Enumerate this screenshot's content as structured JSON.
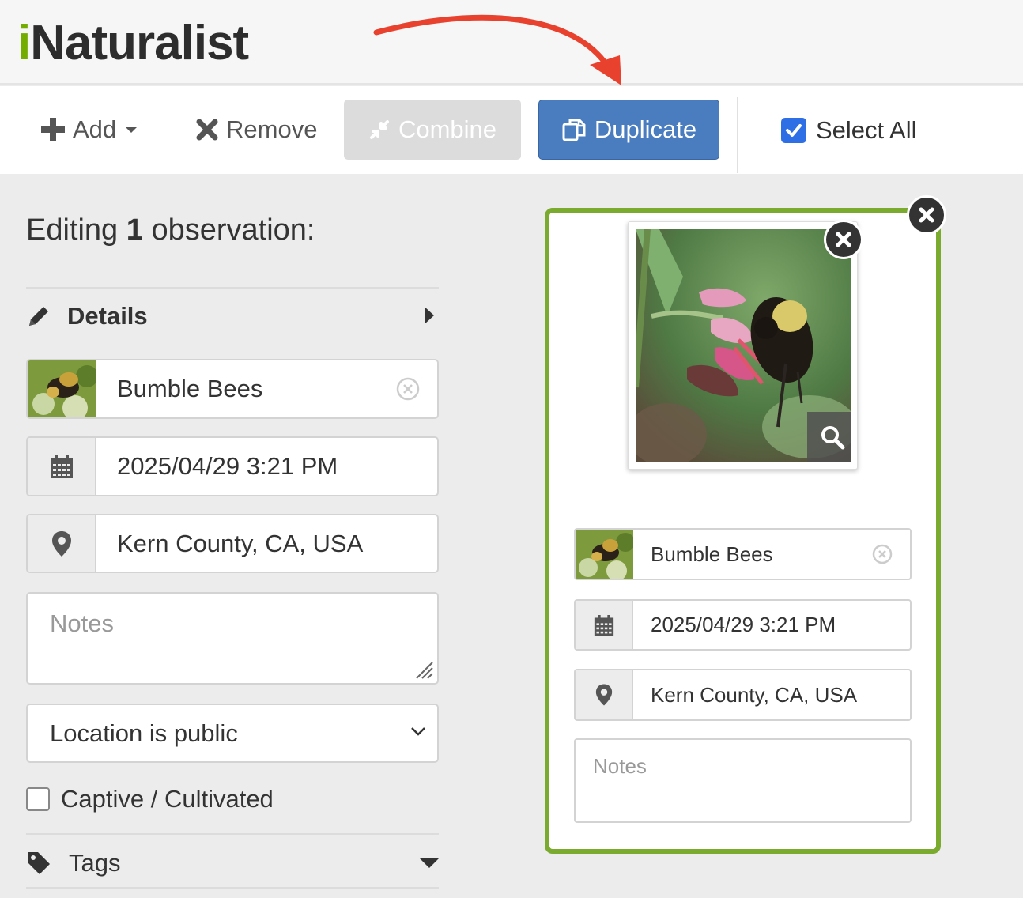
{
  "header": {
    "logo_text": "Naturalist",
    "logo_i": "i",
    "logo_accent_color": "#74ac00"
  },
  "toolbar": {
    "add_label": "Add",
    "remove_label": "Remove",
    "combine_label": "Combine",
    "duplicate_label": "Duplicate",
    "select_all_label": "Select All",
    "select_all_checked": true,
    "duplicate_color": "#4a7dbf"
  },
  "editor": {
    "title_prefix": "Editing",
    "title_count": "1",
    "title_suffix": "observation:",
    "details_label": "Details",
    "taxon": "Bumble Bees",
    "datetime": "2025/04/29 3:21 PM",
    "location": "Kern County, CA, USA",
    "notes_placeholder": "Notes",
    "geoprivacy": "Location is public",
    "captive_label": "Captive / Cultivated",
    "captive_checked": false,
    "tags_label": "Tags"
  },
  "card": {
    "taxon": "Bumble Bees",
    "datetime": "2025/04/29 3:21 PM",
    "location": "Kern County, CA, USA",
    "notes_placeholder": "Notes",
    "border_color": "#7aab2f"
  },
  "icons": [
    "plus-icon",
    "x-icon",
    "combine-icon",
    "duplicate-icon",
    "checkbox-icon",
    "pencil-icon",
    "calendar-icon",
    "map-pin-icon",
    "tag-icon",
    "search-icon",
    "close-icon"
  ]
}
